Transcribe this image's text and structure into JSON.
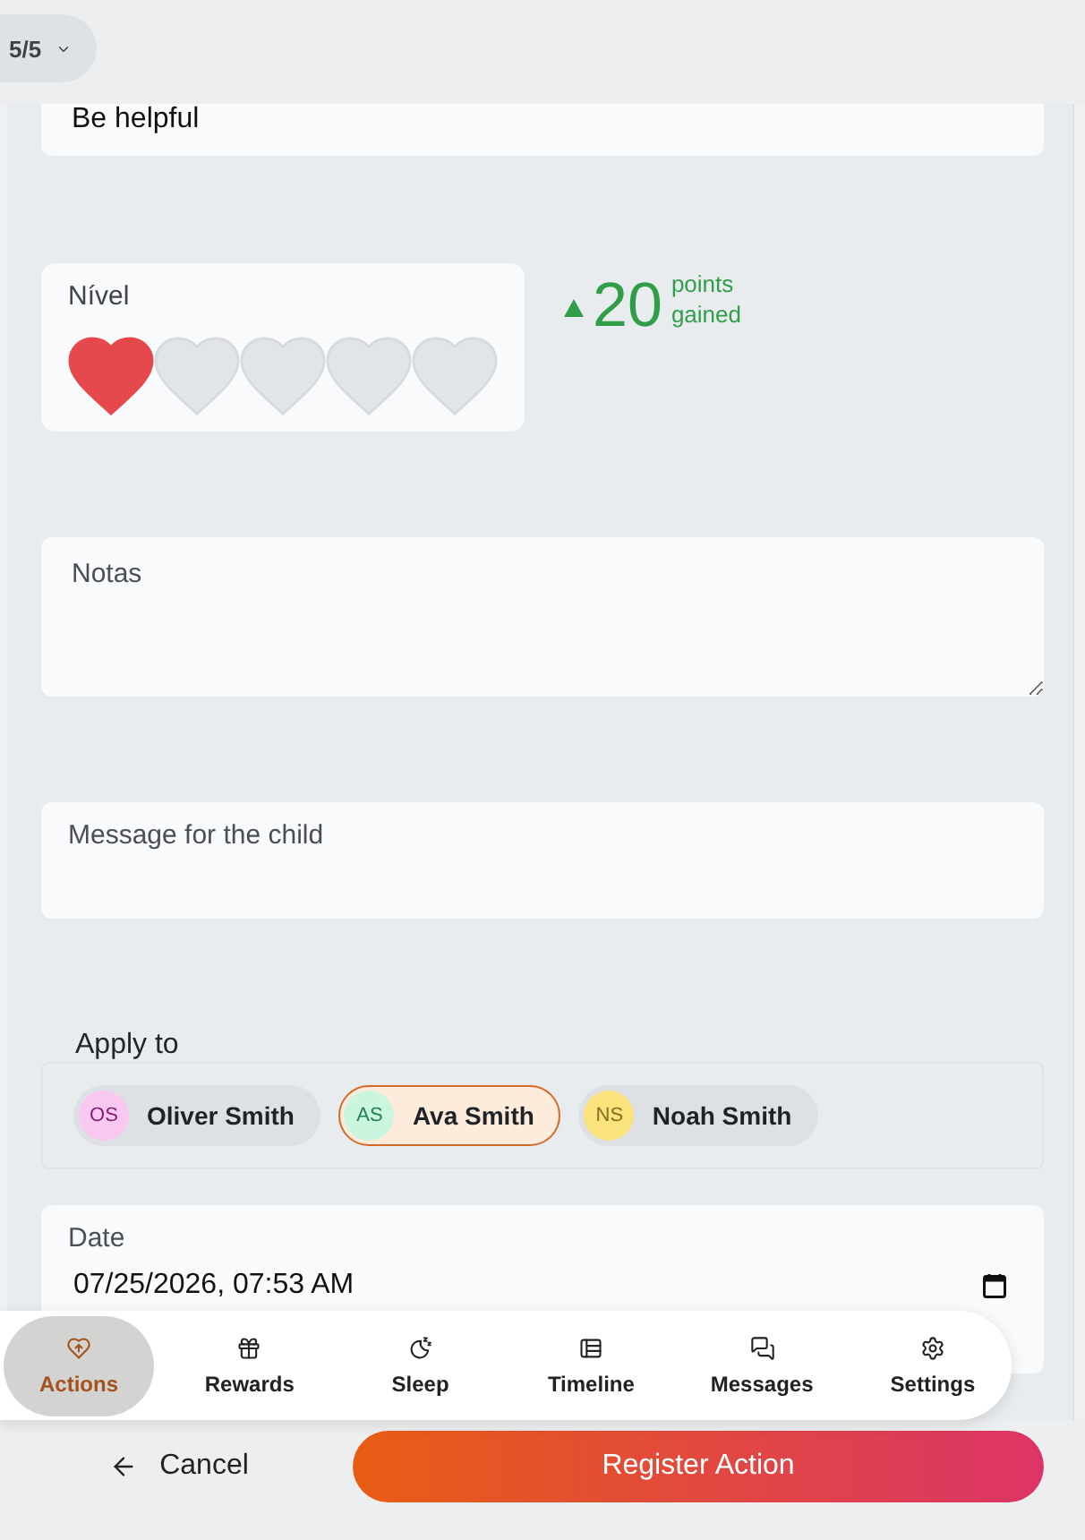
{
  "header": {
    "step_selector": "5/5"
  },
  "form": {
    "title": {
      "value": "Be helpful"
    },
    "level": {
      "label": "Nível",
      "stars": 1
    },
    "points": {
      "up": true,
      "value": "20",
      "label": "points gained"
    },
    "notes": {
      "placeholder": "Notas"
    },
    "message": {
      "placeholder": "Message for the child"
    },
    "apply_to": {
      "label": "Apply to",
      "people": [
        {
          "initials": "OS",
          "name": "Oliver Smith",
          "color": "#f8c8f1",
          "selected": false
        },
        {
          "initials": "AS",
          "name": "Ava Smith",
          "color": "#caf5de",
          "selected": true
        },
        {
          "initials": "NS",
          "name": "Noah Smith",
          "color": "#fce27c",
          "selected": false
        }
      ]
    },
    "date": {
      "label": "Date",
      "value": "07/25/2026, 07:53 AM"
    }
  },
  "bottom_nav": {
    "items": [
      {
        "label": "Actions",
        "selected": true
      },
      {
        "label": "Rewards",
        "selected": false
      },
      {
        "label": "Sleep",
        "selected": false
      },
      {
        "label": "Timeline",
        "selected": false
      },
      {
        "label": "Messages",
        "selected": false
      },
      {
        "label": "Settings",
        "selected": false
      }
    ]
  },
  "footer": {
    "cancel": "Cancel",
    "submit": "Register Action"
  }
}
